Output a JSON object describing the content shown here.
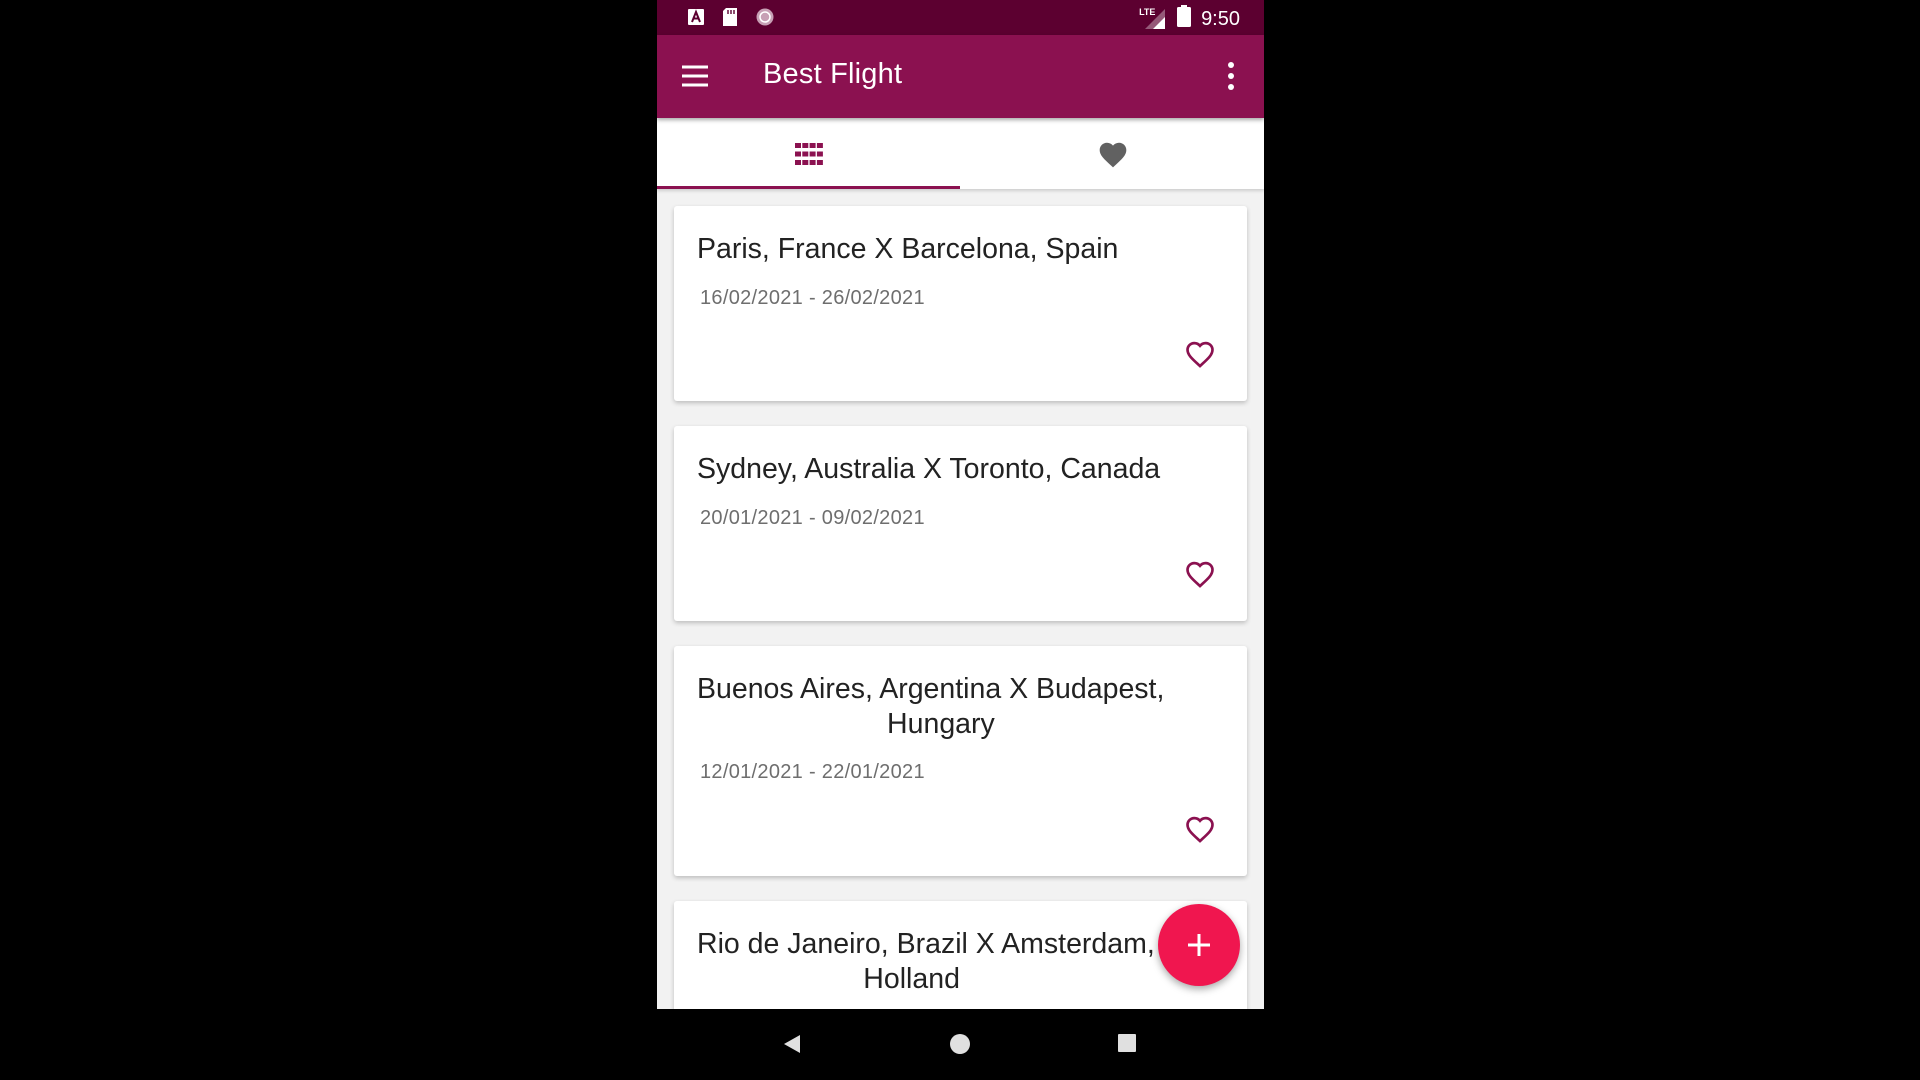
{
  "status_bar": {
    "time": "9:50",
    "network": "LTE",
    "icons": [
      "text-a-icon",
      "sd-card-icon",
      "sync-circle-icon",
      "signal-icon",
      "battery-icon"
    ]
  },
  "app_bar": {
    "title": "Best Flight",
    "icons": [
      "menu-icon",
      "more-vert-icon"
    ]
  },
  "tabs": [
    {
      "icon": "grid-icon",
      "selected": true
    },
    {
      "icon": "heart-icon",
      "selected": false
    }
  ],
  "flights": [
    {
      "title": "Paris, France X Barcelona, Spain",
      "dates": "16/02/2021 - 26/02/2021"
    },
    {
      "title": "Sydney, Australia X Toronto, Canada",
      "dates": "20/01/2021 - 09/02/2021"
    },
    {
      "title": "Buenos Aires, Argentina X Budapest,\n                        Hungary",
      "dates": "12/01/2021 - 22/01/2021"
    },
    {
      "title": "Rio de Janeiro, Brazil X Amsterdam,\n                     Holland",
      "dates": ""
    }
  ],
  "fab": {
    "icon": "plus-icon"
  },
  "nav_bar": {
    "icons": [
      "back-icon",
      "home-icon",
      "recents-icon"
    ]
  },
  "colors": {
    "status_bar": "#5c0030",
    "primary": "#8b1150",
    "fab": "#f0164f",
    "background": "#f2f2f2"
  }
}
